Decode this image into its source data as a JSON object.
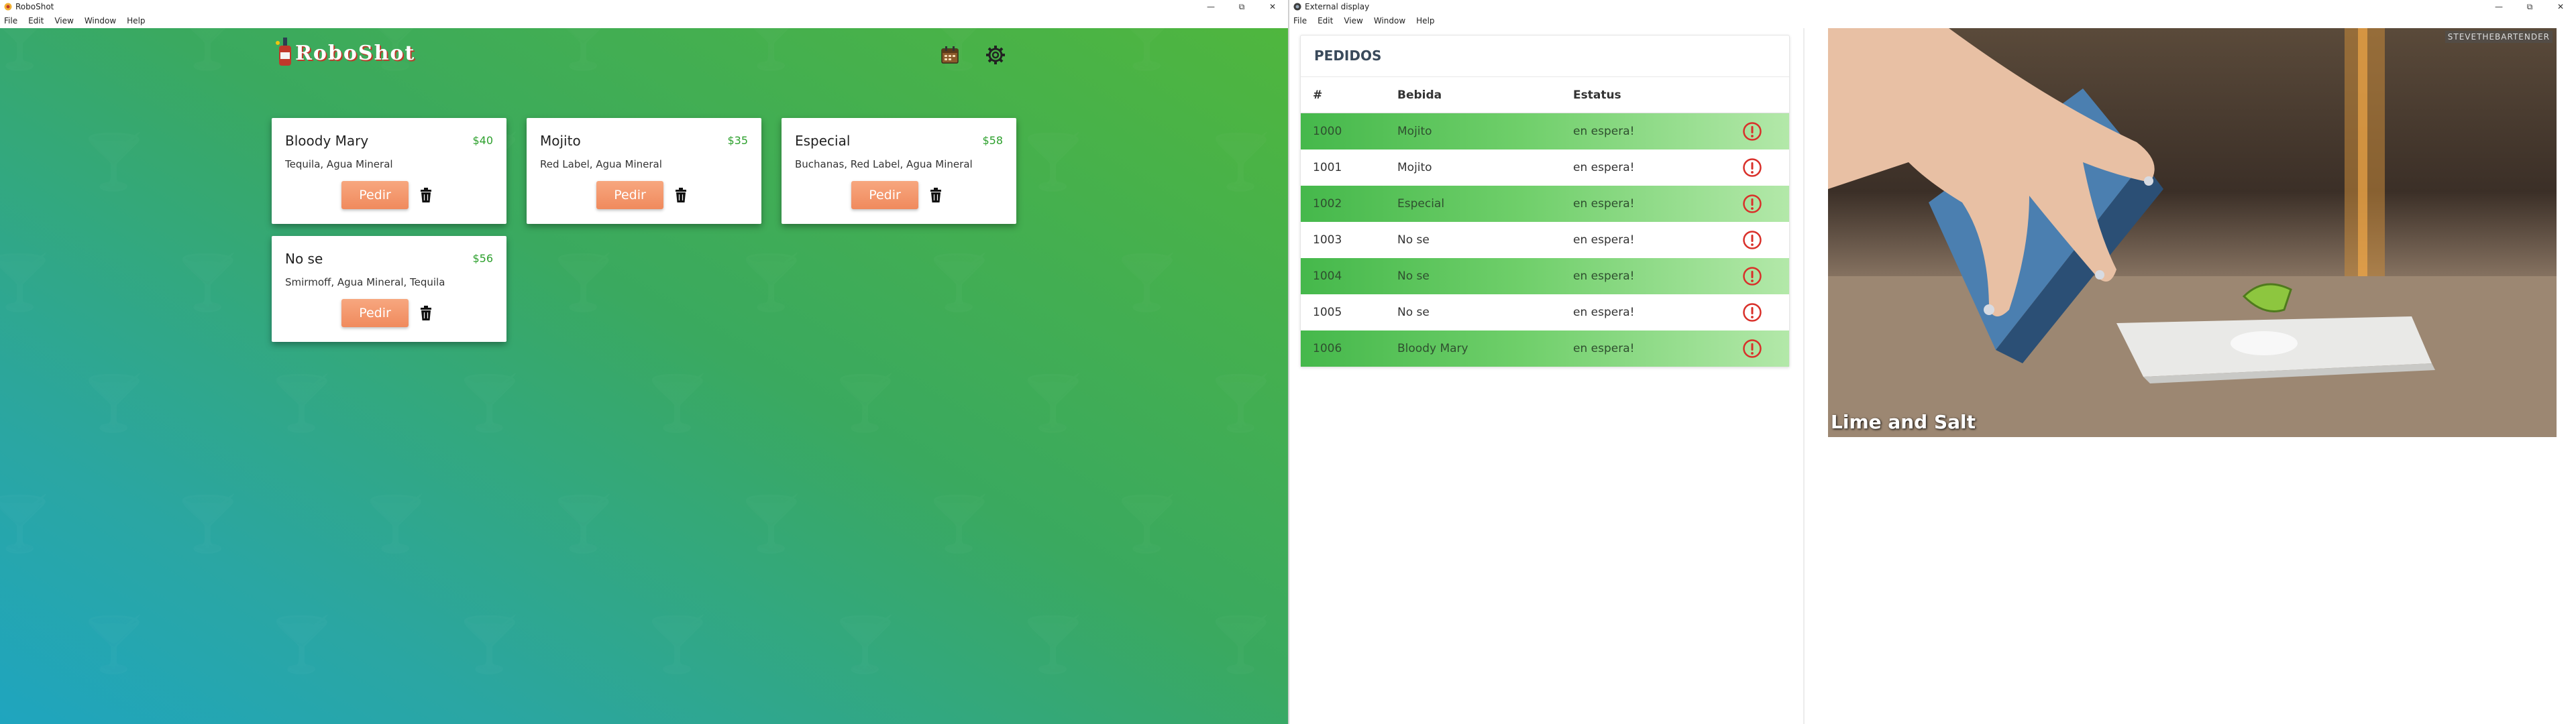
{
  "left_window": {
    "title": "RoboShot",
    "menu": [
      "File",
      "Edit",
      "View",
      "Window",
      "Help"
    ],
    "app": {
      "logo_text": "RoboShot",
      "icons": [
        "calendar-icon",
        "gear-icon"
      ],
      "cards": [
        {
          "name": "Bloody Mary",
          "price": "$40",
          "ingredients": "Tequila, Agua Mineral",
          "button": "Pedir"
        },
        {
          "name": "Mojito",
          "price": "$35",
          "ingredients": "Red Label, Agua Mineral",
          "button": "Pedir"
        },
        {
          "name": "Especial",
          "price": "$58",
          "ingredients": "Buchanas, Red Label, Agua Mineral",
          "button": "Pedir"
        },
        {
          "name": "No se",
          "price": "$56",
          "ingredients": "Smirmoff, Agua Mineral, Tequila",
          "button": "Pedir"
        }
      ]
    }
  },
  "right_window": {
    "title": "External display",
    "menu": [
      "File",
      "Edit",
      "View",
      "Window",
      "Help"
    ],
    "orders": {
      "title": "PEDIDOS",
      "columns": [
        "#",
        "Bebida",
        "Estatus"
      ],
      "rows": [
        {
          "id": "1000",
          "drink": "Mojito",
          "status": "en espera!"
        },
        {
          "id": "1001",
          "drink": "Mojito",
          "status": "en espera!"
        },
        {
          "id": "1002",
          "drink": "Especial",
          "status": "en espera!"
        },
        {
          "id": "1003",
          "drink": "No se",
          "status": "en espera!"
        },
        {
          "id": "1004",
          "drink": "No se",
          "status": "en espera!"
        },
        {
          "id": "1005",
          "drink": "No se",
          "status": "en espera!"
        },
        {
          "id": "1006",
          "drink": "Bloody Mary",
          "status": "en espera!"
        }
      ]
    },
    "video": {
      "caption": "Lime and Salt",
      "watermark": "STEVETHEBARTENDER"
    }
  },
  "colors": {
    "accent_green": "#4fb63e",
    "alert_red": "#d9302a",
    "button_orange": "#f08a5d",
    "price_green": "#2da02d"
  }
}
